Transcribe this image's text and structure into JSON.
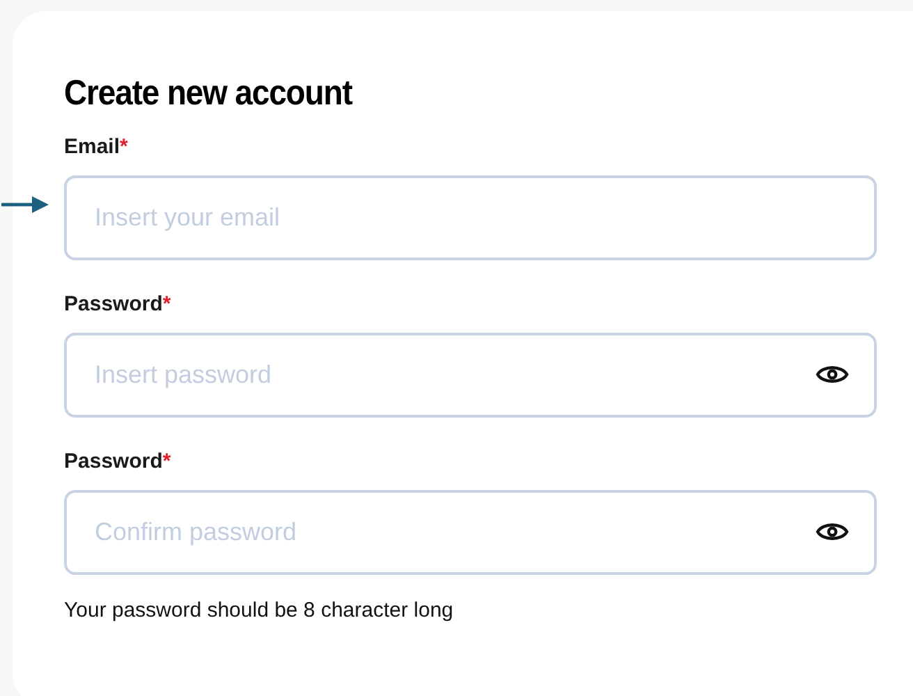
{
  "title": "Create new account",
  "fields": [
    {
      "kind": "email",
      "label": "Email",
      "required_mark": "*",
      "placeholder": "Insert your email",
      "pointed_at": true
    },
    {
      "kind": "password",
      "label": "Password",
      "required_mark": "*",
      "placeholder": "Insert password",
      "pointed_at": false
    },
    {
      "kind": "password",
      "label": "Password",
      "required_mark": "*",
      "placeholder": "Confirm password",
      "pointed_at": false
    }
  ],
  "hint": "Your password should be 8 character long"
}
